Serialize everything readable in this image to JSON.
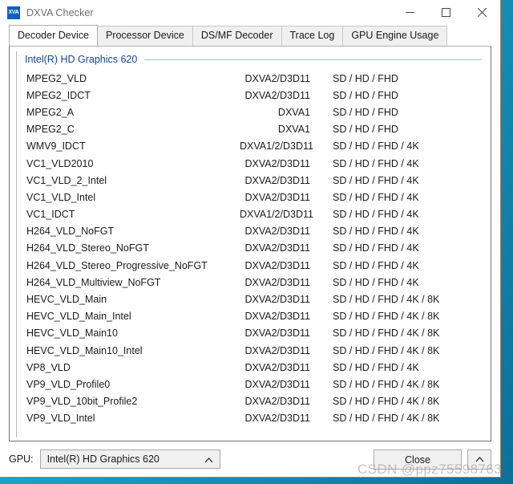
{
  "window": {
    "title": "DXVA Checker",
    "icon_label": "XVA",
    "controls": {
      "minimize": "minimize-icon",
      "maximize": "maximize-icon",
      "close": "close-icon"
    }
  },
  "tabs": [
    {
      "label": "Decoder Device",
      "active": true
    },
    {
      "label": "Processor Device",
      "active": false
    },
    {
      "label": "DS/MF Decoder",
      "active": false
    },
    {
      "label": "Trace Log",
      "active": false
    },
    {
      "label": "GPU Engine Usage",
      "active": false
    }
  ],
  "group": {
    "title": "Intel(R) HD Graphics 620"
  },
  "rows": [
    {
      "name": "MPEG2_VLD",
      "api": "DXVA2/D3D11",
      "res": "SD / HD / FHD"
    },
    {
      "name": "MPEG2_IDCT",
      "api": "DXVA2/D3D11",
      "res": "SD / HD / FHD"
    },
    {
      "name": "MPEG2_A",
      "api": "DXVA1",
      "res": "SD / HD / FHD"
    },
    {
      "name": "MPEG2_C",
      "api": "DXVA1",
      "res": "SD / HD / FHD"
    },
    {
      "name": "WMV9_IDCT",
      "api": "DXVA1/2/D3D11",
      "res": "SD / HD / FHD / 4K"
    },
    {
      "name": "VC1_VLD2010",
      "api": "DXVA2/D3D11",
      "res": "SD / HD / FHD / 4K"
    },
    {
      "name": "VC1_VLD_2_Intel",
      "api": "DXVA2/D3D11",
      "res": "SD / HD / FHD / 4K"
    },
    {
      "name": "VC1_VLD_Intel",
      "api": "DXVA2/D3D11",
      "res": "SD / HD / FHD / 4K"
    },
    {
      "name": "VC1_IDCT",
      "api": "DXVA1/2/D3D11",
      "res": "SD / HD / FHD / 4K"
    },
    {
      "name": "H264_VLD_NoFGT",
      "api": "DXVA2/D3D11",
      "res": "SD / HD / FHD / 4K"
    },
    {
      "name": "H264_VLD_Stereo_NoFGT",
      "api": "DXVA2/D3D11",
      "res": "SD / HD / FHD / 4K"
    },
    {
      "name": "H264_VLD_Stereo_Progressive_NoFGT",
      "api": "DXVA2/D3D11",
      "res": "SD / HD / FHD / 4K"
    },
    {
      "name": "H264_VLD_Multiview_NoFGT",
      "api": "DXVA2/D3D11",
      "res": "SD / HD / FHD / 4K"
    },
    {
      "name": "HEVC_VLD_Main",
      "api": "DXVA2/D3D11",
      "res": "SD / HD / FHD / 4K / 8K"
    },
    {
      "name": "HEVC_VLD_Main_Intel",
      "api": "DXVA2/D3D11",
      "res": "SD / HD / FHD / 4K / 8K"
    },
    {
      "name": "HEVC_VLD_Main10",
      "api": "DXVA2/D3D11",
      "res": "SD / HD / FHD / 4K / 8K"
    },
    {
      "name": "HEVC_VLD_Main10_Intel",
      "api": "DXVA2/D3D11",
      "res": "SD / HD / FHD / 4K / 8K"
    },
    {
      "name": "VP8_VLD",
      "api": "DXVA2/D3D11",
      "res": "SD / HD / FHD / 4K"
    },
    {
      "name": "VP9_VLD_Profile0",
      "api": "DXVA2/D3D11",
      "res": "SD / HD / FHD / 4K / 8K"
    },
    {
      "name": "VP9_VLD_10bit_Profile2",
      "api": "DXVA2/D3D11",
      "res": "SD / HD / FHD / 4K / 8K"
    },
    {
      "name": "VP9_VLD_Intel",
      "api": "DXVA2/D3D11",
      "res": "SD / HD / FHD / 4K / 8K"
    }
  ],
  "bottom": {
    "gpu_label": "GPU:",
    "gpu_value": "Intel(R) HD Graphics 620",
    "close_label": "Close",
    "expand_icon": "chevron-up-icon"
  },
  "watermark": "CSDN @ppz75598763",
  "colors": {
    "group_title": "#17458f",
    "group_rule": "#a8bede",
    "desktop": "#1491b8",
    "icon_bg": "#1060c0"
  }
}
